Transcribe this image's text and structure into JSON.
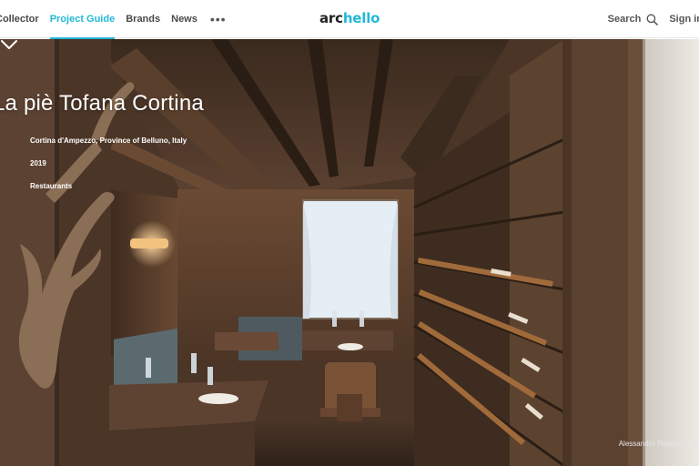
{
  "nav": {
    "items": [
      {
        "label": "Collector",
        "active": false
      },
      {
        "label": "Project Guide",
        "active": true
      },
      {
        "label": "Brands",
        "active": false
      },
      {
        "label": "News",
        "active": false
      }
    ],
    "more_icon": "ellipsis-icon",
    "search_label": "Search",
    "search_icon": "search-icon",
    "signin_label": "Sign in"
  },
  "logo": {
    "part1": "arc",
    "part2": "hello"
  },
  "project": {
    "title": "La piè Tofana Cortina",
    "location": "Cortina d'Ampezzo, Province of Belluno, Italy",
    "year": "2019",
    "category": "Restaurants"
  },
  "photo_credit": "Alessandro Paderni / Eye",
  "scroll_icon": "chevron-down-icon",
  "colors": {
    "accent": "#22b8d6",
    "nav_text": "#4a4a4a"
  }
}
